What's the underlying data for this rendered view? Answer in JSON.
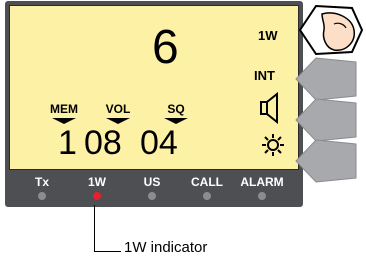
{
  "lcd": {
    "channel": "6",
    "power_mode": "1W",
    "int_label": "INT",
    "mem_label": "MEM",
    "vol_label": "VOL",
    "sq_label": "SQ",
    "mem_value": "1",
    "vol_value": "08",
    "sq_value": "04"
  },
  "indicators": [
    {
      "label": "Tx",
      "active": false
    },
    {
      "label": "1W",
      "active": true
    },
    {
      "label": "US",
      "active": false
    },
    {
      "label": "CALL",
      "active": false
    },
    {
      "label": "ALARM",
      "active": false
    }
  ],
  "side_buttons": [
    {
      "icon": "finger-press-icon",
      "pressed": true
    },
    {
      "icon": "side-button-icon",
      "pressed": false
    },
    {
      "icon": "side-button-icon",
      "pressed": false
    },
    {
      "icon": "side-button-icon",
      "pressed": false
    }
  ],
  "lcd_icons": [
    "speaker-icon",
    "brightness-icon"
  ],
  "callout": {
    "text": "1W indicator"
  },
  "colors": {
    "lcd_bg": "#fdf1a6",
    "bezel": "#4d4f52",
    "led_off": "#8a8c8f",
    "led_on": "#e8202a"
  }
}
